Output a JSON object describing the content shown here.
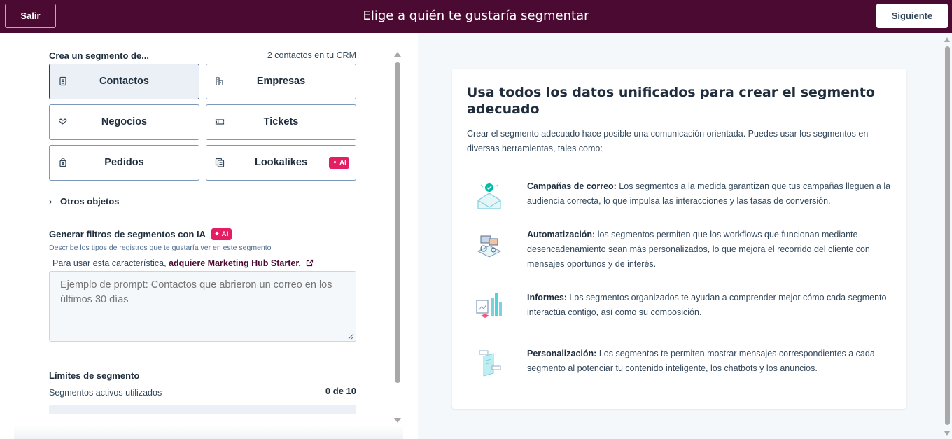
{
  "header": {
    "exit_label": "Salir",
    "title": "Elige a quién te gustaría segmentar",
    "next_label": "Siguiente"
  },
  "segment": {
    "heading": "Crea un segmento de...",
    "crm_count": "2 contactos en tu CRM",
    "tiles": [
      {
        "label": "Contactos",
        "icon": "contact-card-icon",
        "selected": true
      },
      {
        "label": "Empresas",
        "icon": "building-icon",
        "selected": false
      },
      {
        "label": "Negocios",
        "icon": "handshake-icon",
        "selected": false
      },
      {
        "label": "Tickets",
        "icon": "ticket-icon",
        "selected": false
      },
      {
        "label": "Pedidos",
        "icon": "shopping-bag-icon",
        "selected": false
      },
      {
        "label": "Lookalikes",
        "icon": "lookalike-cards-icon",
        "selected": false,
        "badge": "✦ AI"
      }
    ],
    "other_objects": "Otros objetos"
  },
  "ai_filters": {
    "heading": "Generar filtros de segmentos con IA",
    "badge": "✦ AI",
    "description": "Describe los tipos de registros que te gustaría ver en este segmento",
    "upgrade_prefix": "Para usar esta característica,",
    "upgrade_link": "adquiere Marketing Hub Starter.",
    "prompt_placeholder": "Ejemplo de prompt: Contactos que abrieron un correo en los últimos 30 días",
    "prompt_value": ""
  },
  "limits": {
    "heading": "Límites de segmento",
    "active_label": "Segmentos activos utilizados",
    "active_value": "0 de 10",
    "used_fraction": 0
  },
  "info": {
    "title": "Usa todos los datos unificados para crear el segmento adecuado",
    "intro": "Crear el segmento adecuado hace posible una comunicación orientada. Puedes usar los segmentos en diversas herramientas, tales como:",
    "features": [
      {
        "icon": "email-campaign-icon",
        "title": "Campañas de correo:",
        "text": " Los segmentos a la medida garantizan que tus campañas lleguen a la audiencia correcta, lo que impulsa las interacciones y las tasas de conversión."
      },
      {
        "icon": "automation-icon",
        "title": "Automatización:",
        "text": " los segmentos permiten que los workflows que funcionan mediante desencadenamiento sean más personalizados, lo que mejora el recorrido del cliente con mensajes oportunos y de interés."
      },
      {
        "icon": "reports-icon",
        "title": "Informes:",
        "text": " Los segmentos organizados te ayudan a comprender mejor cómo cada segmento interactúa contigo, así como su composición."
      },
      {
        "icon": "personalization-icon",
        "title": "Personalización:",
        "text": " Los segmentos te permiten mostrar mensajes correspondientes a cada segmento al potenciar tu contenido inteligente, los chatbots y los anuncios."
      }
    ]
  },
  "colors": {
    "header_bg": "#4a0a32",
    "ai_badge": "#e41e63",
    "link": "#4a0a32"
  }
}
